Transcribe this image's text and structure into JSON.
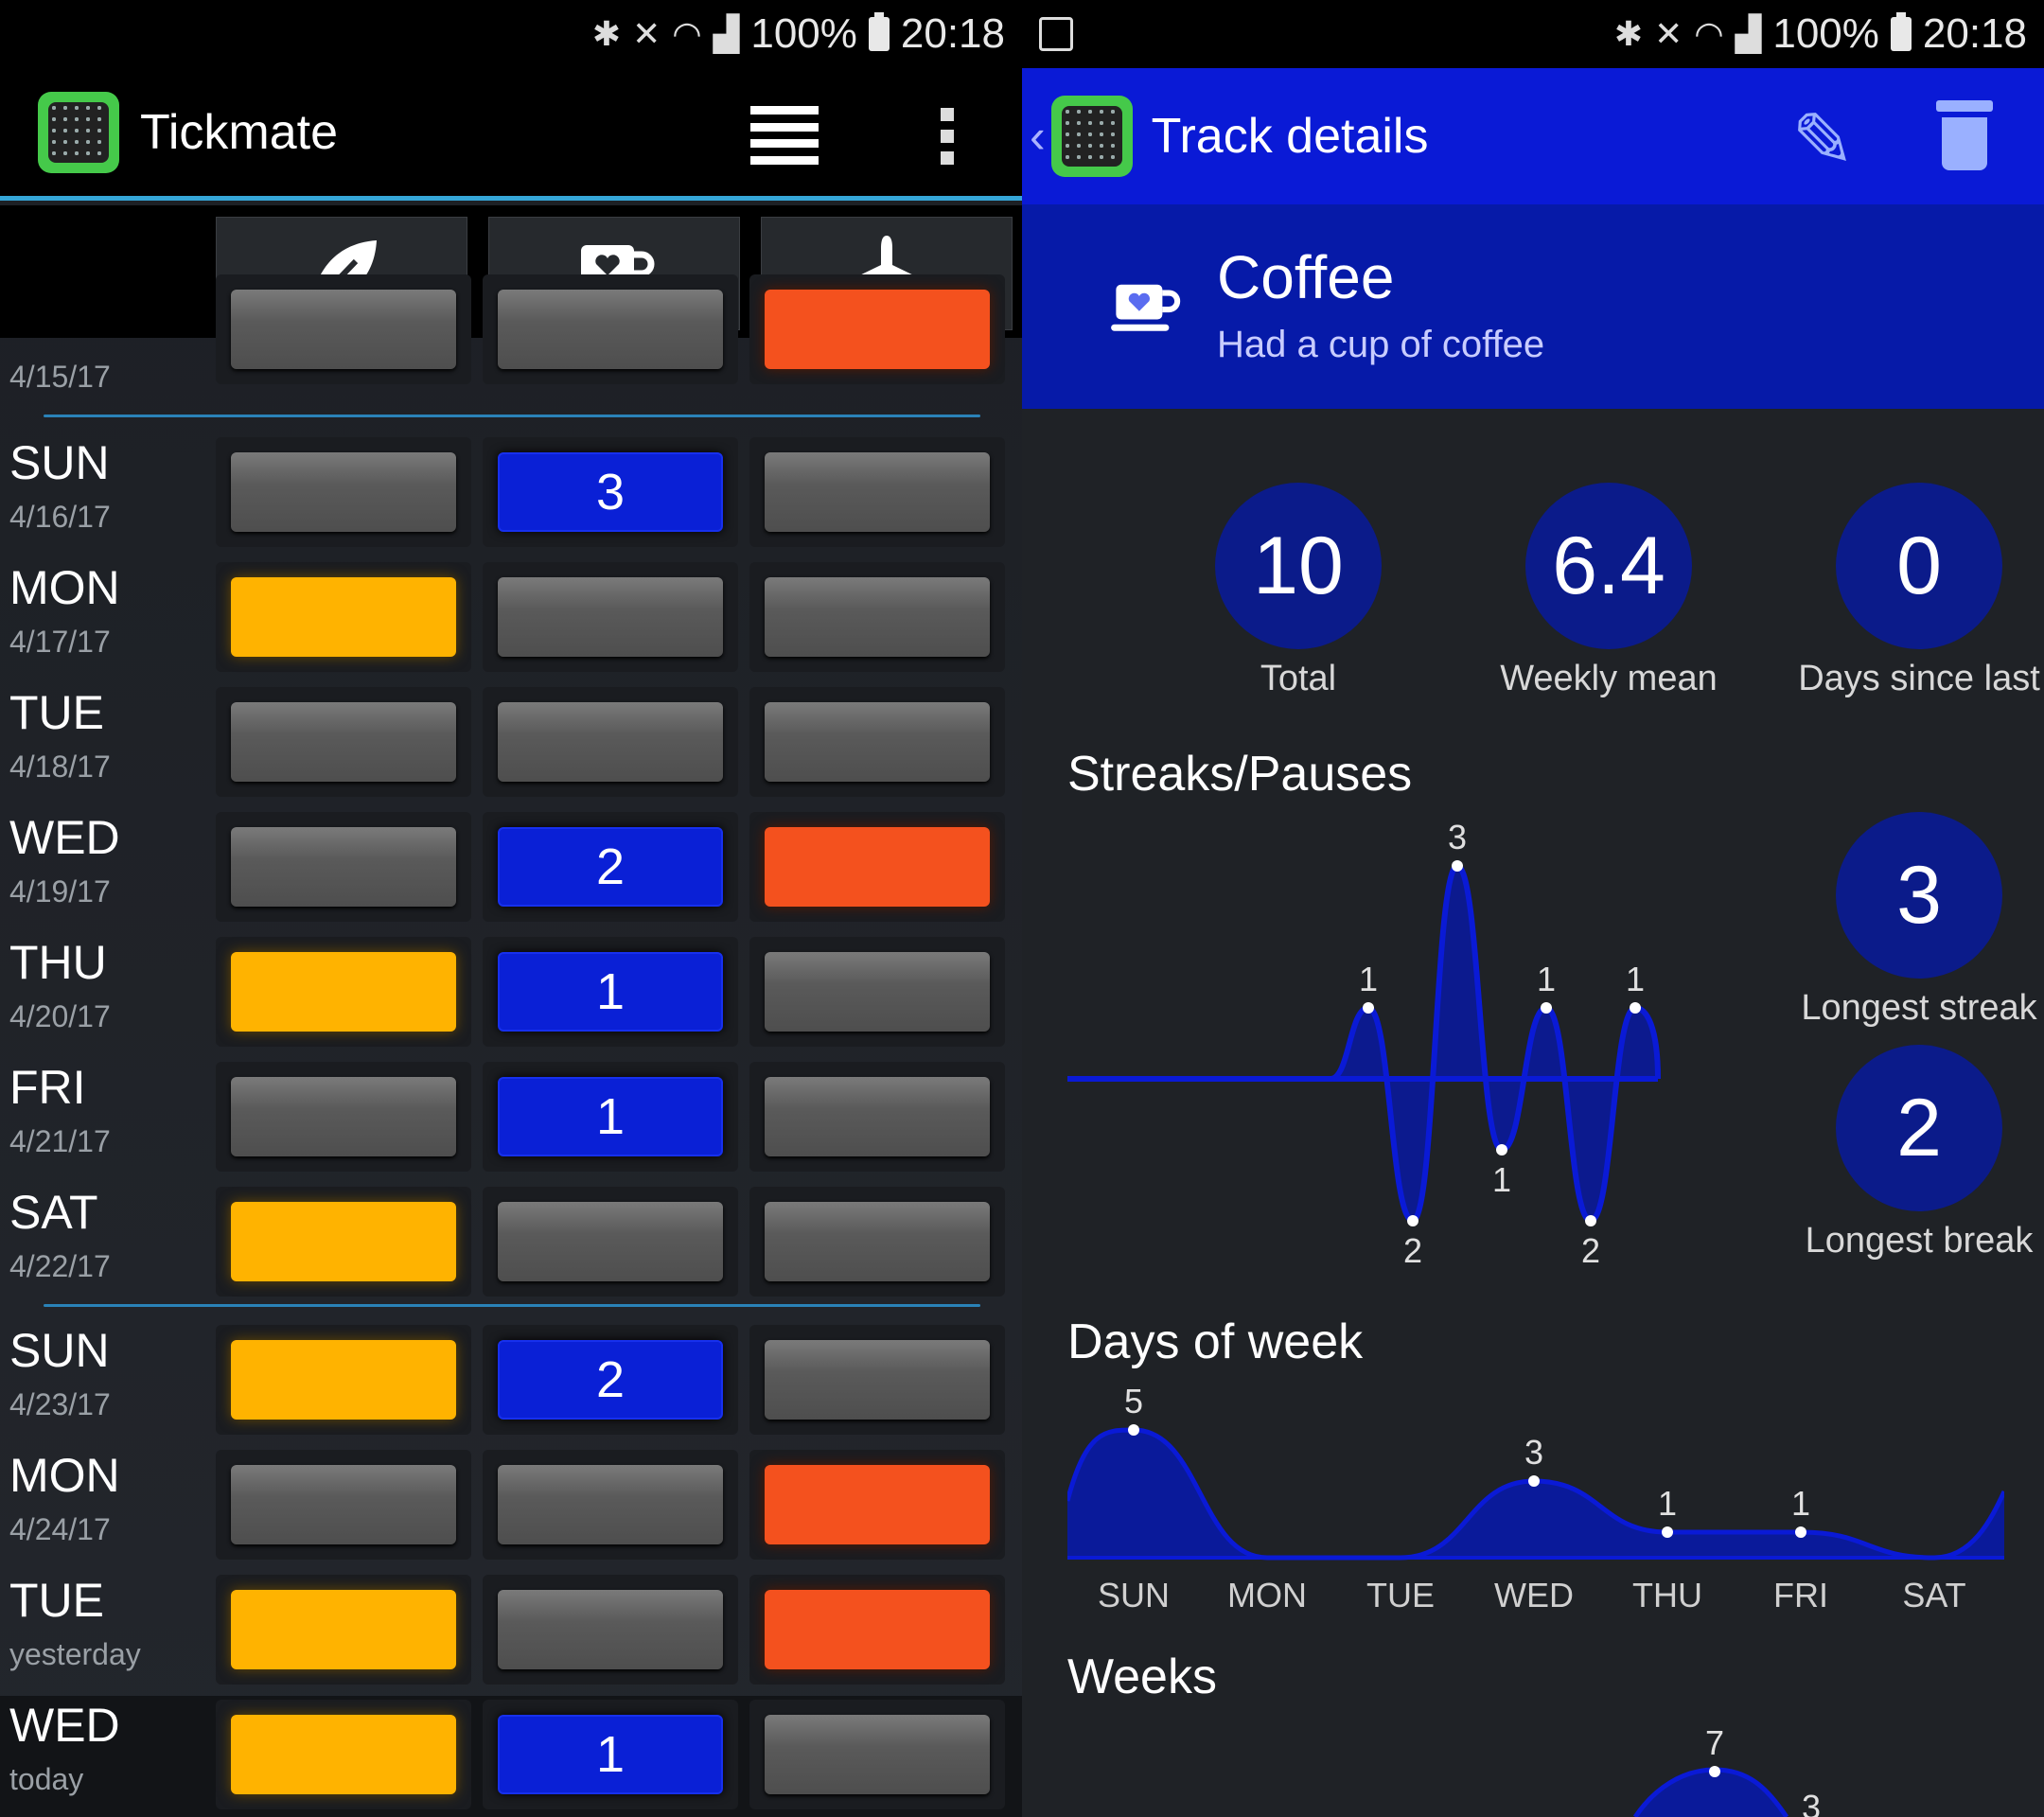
{
  "status_bar": {
    "battery": "100%",
    "time": "20:18"
  },
  "left": {
    "app_title": "Tickmate",
    "tracks": [
      {
        "icon": "leaf-icon"
      },
      {
        "icon": "coffee-cup-icon"
      },
      {
        "icon": "airplane-icon"
      }
    ],
    "partial_row": {
      "date": "4/15/17"
    },
    "rows": [
      {
        "day": "SUN",
        "date": "4/16/17"
      },
      {
        "day": "MON",
        "date": "4/17/17"
      },
      {
        "day": "TUE",
        "date": "4/18/17"
      },
      {
        "day": "WED",
        "date": "4/19/17"
      },
      {
        "day": "THU",
        "date": "4/20/17"
      },
      {
        "day": "FRI",
        "date": "4/21/17"
      },
      {
        "day": "SAT",
        "date": "4/22/17"
      },
      {
        "day": "SUN",
        "date": "4/23/17"
      },
      {
        "day": "MON",
        "date": "4/24/17"
      },
      {
        "day": "TUE",
        "date": "yesterday"
      },
      {
        "day": "WED",
        "date": "today"
      }
    ],
    "ticks": [
      [
        "grey",
        "blue:3",
        "grey"
      ],
      [
        "yellow",
        "grey",
        "grey"
      ],
      [
        "grey",
        "grey",
        "grey"
      ],
      [
        "grey",
        "blue:2",
        "orange"
      ],
      [
        "yellow",
        "blue:1",
        "grey"
      ],
      [
        "grey",
        "blue:1",
        "grey"
      ],
      [
        "yellow",
        "grey",
        "grey"
      ],
      [
        "yellow",
        "blue:2",
        "grey"
      ],
      [
        "grey",
        "grey",
        "orange"
      ],
      [
        "yellow",
        "grey",
        "orange"
      ],
      [
        "yellow",
        "blue:1",
        "grey"
      ]
    ],
    "colors": {
      "yellow": "#ffb300",
      "orange": "#f4511e",
      "blue": "#0a20d6",
      "accent": "#35a6d8"
    }
  },
  "right": {
    "title": "Track details",
    "track_name": "Coffee",
    "track_description": "Had a cup of coffee",
    "stats": [
      {
        "value": "10",
        "label": "Total"
      },
      {
        "value": "6.4",
        "label": "Weekly mean"
      },
      {
        "value": "0",
        "label": "Days since last"
      }
    ],
    "streaks_title": "Streaks/Pauses",
    "longest_streak": {
      "value": "3",
      "label": "Longest streak"
    },
    "longest_break": {
      "value": "2",
      "label": "Longest break"
    },
    "days_of_week_title": "Days of week",
    "weeks_title": "Weeks",
    "colors": {
      "bar": "#0a1ad6",
      "header": "#061aa8",
      "circle": "#0b1b8a"
    }
  },
  "chart_data": [
    {
      "type": "line",
      "title": "Streaks/Pauses",
      "points": [
        {
          "label": "1",
          "sign": 1
        },
        {
          "label": "2",
          "sign": -1
        },
        {
          "label": "3",
          "sign": 1
        },
        {
          "label": "1",
          "sign": -1
        },
        {
          "label": "1",
          "sign": 1
        },
        {
          "label": "2",
          "sign": -1
        },
        {
          "label": "1",
          "sign": 1
        }
      ],
      "values": [
        1,
        -2,
        3,
        -1,
        1,
        -2,
        1
      ]
    },
    {
      "type": "area",
      "title": "Days of week",
      "categories": [
        "SUN",
        "MON",
        "TUE",
        "WED",
        "THU",
        "FRI",
        "SAT"
      ],
      "values": [
        5,
        0,
        0,
        3,
        1,
        1,
        0
      ]
    },
    {
      "type": "area",
      "title": "Weeks",
      "visible_labels": [
        "7",
        "3"
      ]
    }
  ]
}
